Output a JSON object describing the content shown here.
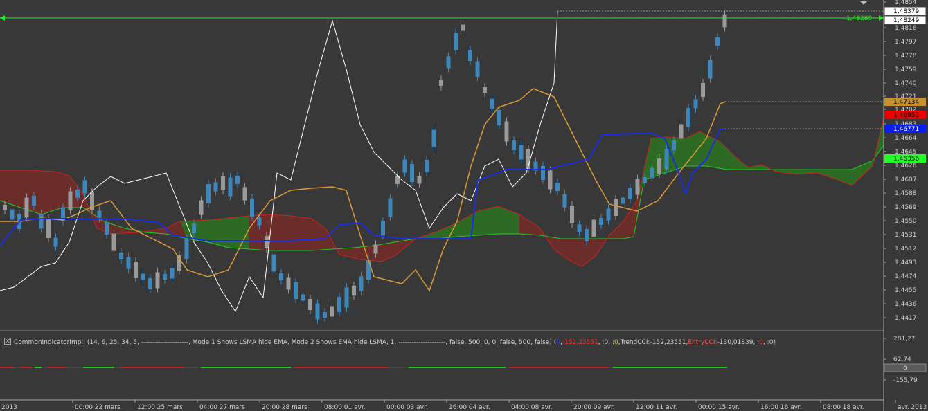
{
  "colors": {
    "background": "#383838",
    "bull_candle": "#3d87bd",
    "bear_candle": "#9a9a9a",
    "kumo_bull": "#2d6b24",
    "kumo_bear": "#6e2c28",
    "span_a": "#22cc22",
    "span_b": "#cc2222",
    "tenkan": "#d89a3a",
    "kijun": "#1a2fe0",
    "chikou": "#ffffff",
    "price_line": "#22ee22"
  },
  "price_axis": {
    "ticks": [
      "1,4854",
      "1,4816",
      "1,4797",
      "1,4778",
      "1,4759",
      "1,4740",
      "1,4721",
      "1,4702",
      "1,4683",
      "1,4664",
      "1,4645",
      "1,4626",
      "1,4607",
      "1,4588",
      "1,4569",
      "1,4550",
      "1,4531",
      "1,4512",
      "1,4493",
      "1,4474",
      "1,4455",
      "1,4436",
      "1,4417"
    ],
    "tags": {
      "ask": "1,48379",
      "bid": "1,48249",
      "current": "1,48289",
      "tenkan": "1,47134",
      "span_b": "1,46953",
      "kijun": "1,46771",
      "span_a": "1,46356"
    }
  },
  "time_axis": {
    "labels": [
      "2013",
      "00:00 22 mars",
      "12:00 25 mars",
      "04:00 27 mars",
      "20:00 28 mars",
      "08:00 01 avr.",
      "00:00 03 avr.",
      "16:00 04 avr.",
      "04:00 08 avr.",
      "20:00 09 avr.",
      "12:00 11 avr.",
      "00:00 15 avr.",
      "16:00 16 avr.",
      "08:00 18 avr.",
      "avr. 2013"
    ]
  },
  "indicator": {
    "legend": {
      "name": "CommonIndicatorImpl: (14, 6, 25, 34, 5, ---------------------, Mode 1 Shows LSMA hide EMA, Mode 2 Shows EMA hide LSMA, 1, ---------------------, false, 500, 0, 0, false, 500, false) (",
      "v1": "0",
      "sep1": ", ",
      "v2": "-152,23551",
      "sep2": ", : ",
      "v3": "0",
      "sep3": ", : ",
      "v4": "0",
      "sep4": ", ",
      "trend_label": "TrendCCI: ",
      "trend_value": "-152,23551",
      "sep5": ", ",
      "entry_label": "EntryCCI: ",
      "entry_value": "-130,01839",
      "sep6": ", : ",
      "v5": "0",
      "sep7": ", : ",
      "v6": "0",
      "close": ")"
    },
    "axis_ticks": [
      "281,27",
      "62,74",
      "-155,79"
    ],
    "zero_tag": "0"
  }
}
